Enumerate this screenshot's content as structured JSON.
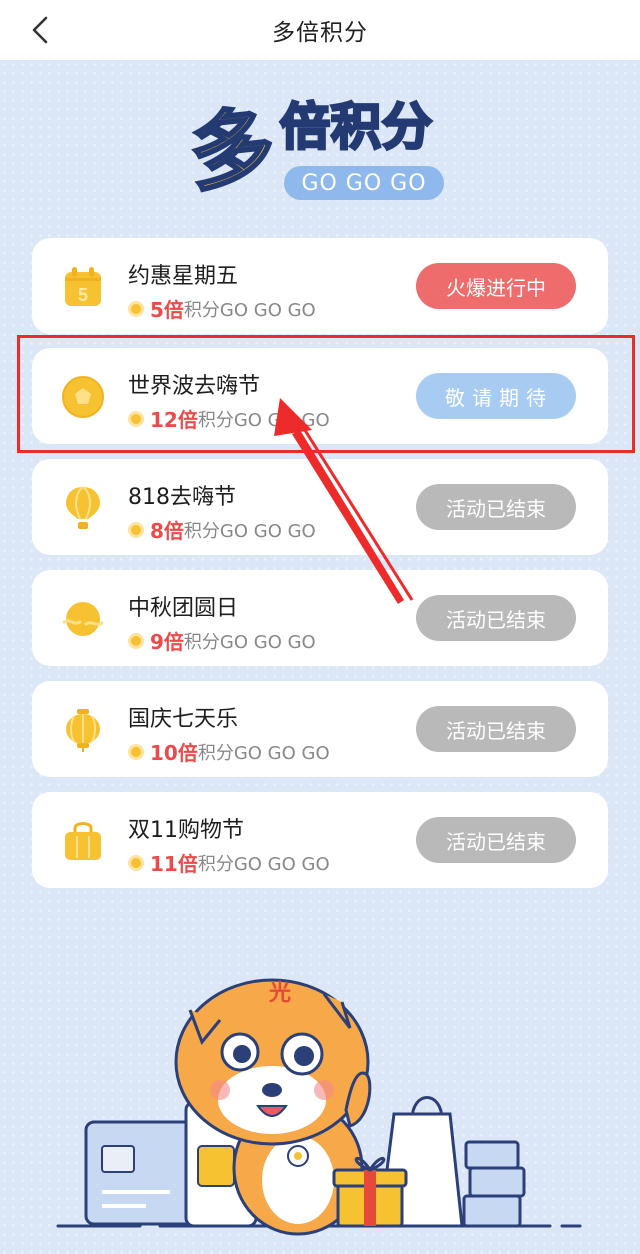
{
  "navbar": {
    "title": "多倍积分"
  },
  "logo": {
    "big_char": "多",
    "small_text": "倍积分",
    "pill_text": "GO GO GO"
  },
  "activities": [
    {
      "title": "约惠星期五",
      "multiplier": "5倍",
      "suffix": "积分GO GO GO",
      "status": "火爆进行中",
      "status_type": "hot",
      "icon": "calendar-icon",
      "icon_text": "5"
    },
    {
      "title": "世界波去嗨节",
      "multiplier": "12倍",
      "suffix": "积分GO GO GO",
      "status": "敬请期待",
      "status_type": "soon",
      "icon": "soccer-ball-icon"
    },
    {
      "title": "818去嗨节",
      "multiplier": "8倍",
      "suffix": "积分GO GO GO",
      "status": "活动已结束",
      "status_type": "ended",
      "icon": "hot-air-balloon-icon"
    },
    {
      "title": "中秋团圆日",
      "multiplier": "9倍",
      "suffix": "积分GO GO GO",
      "status": "活动已结束",
      "status_type": "ended",
      "icon": "moon-icon"
    },
    {
      "title": "国庆七天乐",
      "multiplier": "10倍",
      "suffix": "积分GO GO GO",
      "status": "活动已结束",
      "status_type": "ended",
      "icon": "lantern-icon"
    },
    {
      "title": "双11购物节",
      "multiplier": "11倍",
      "suffix": "积分GO GO GO",
      "status": "活动已结束",
      "status_type": "ended",
      "icon": "shopping-bag-icon"
    }
  ],
  "mascot": {
    "hat_char": "光"
  },
  "colors": {
    "page_bg": "#dbe6f7",
    "multiplier": "#ef4a4a",
    "btn_hot": "#ee6c6c",
    "btn_soon": "#a8cbf2",
    "btn_ended": "#b9b9b9",
    "icon_yellow": "#f6c232",
    "highlight": "#ee2b2b"
  }
}
